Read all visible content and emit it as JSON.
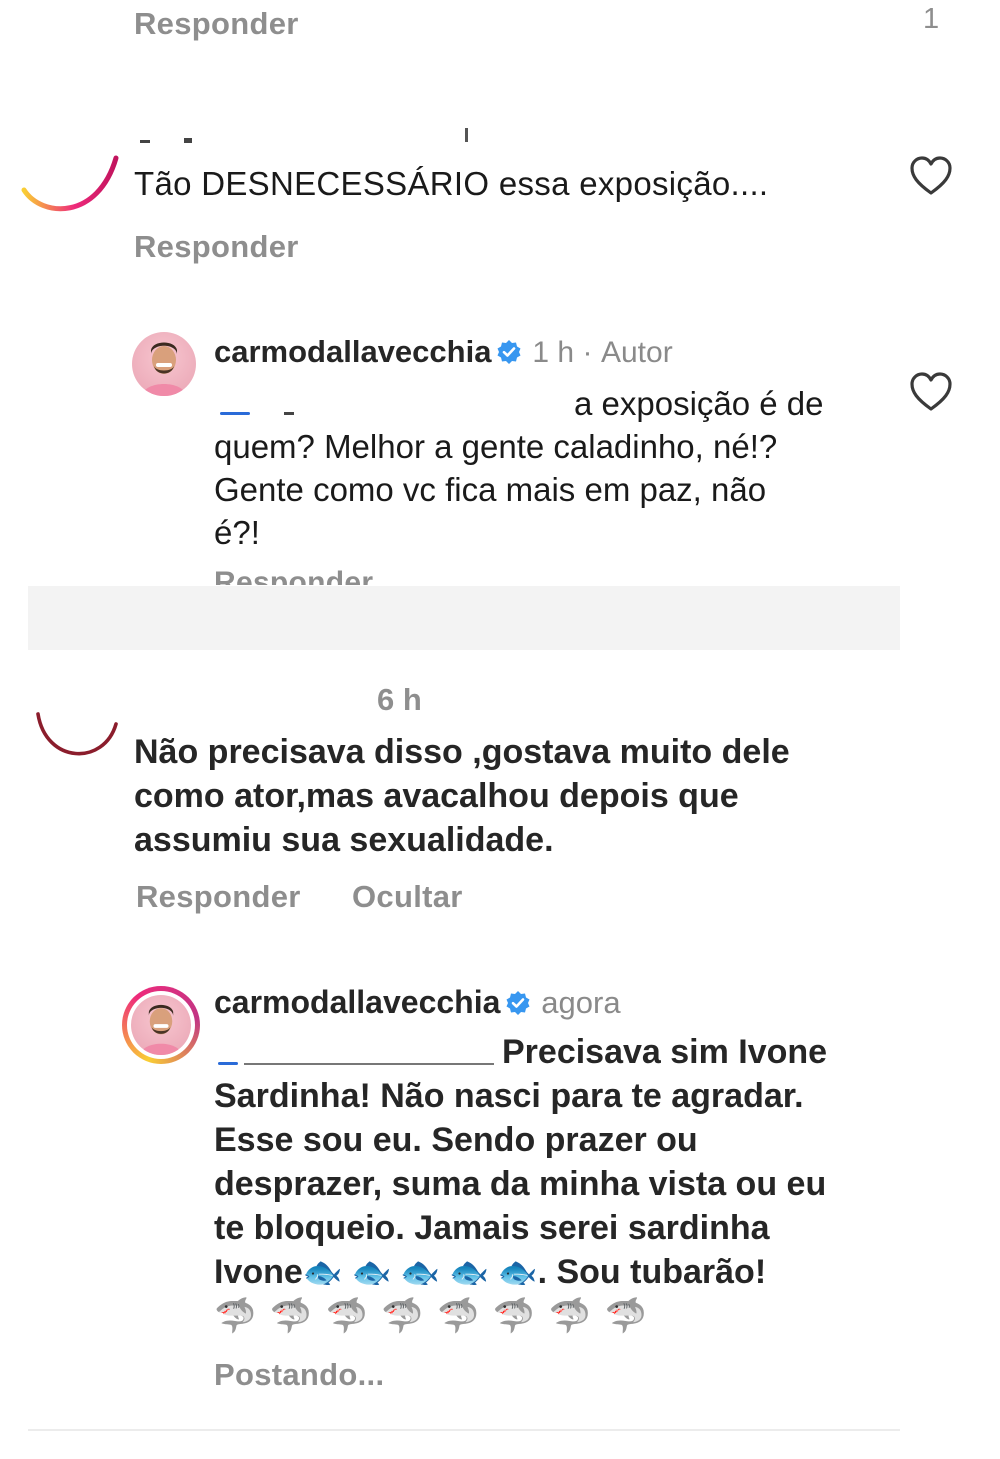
{
  "thread1": {
    "reply_label": "Responder",
    "like_count": "1"
  },
  "comment1": {
    "text": "Tão  DESNECESSÁRIO  essa  exposição....",
    "reply_label": "Responder"
  },
  "reply1": {
    "username": "carmodallavecchia",
    "time": "1 h",
    "separator": "·",
    "author_badge": "Autor",
    "text_line1": "a exposição é de",
    "text_line2": "quem? Melhor a gente caladinho, né!?",
    "text_line3": "Gente como vc fica mais em paz, não",
    "text_line4": "é?!",
    "reply_label": "Responder"
  },
  "comment2": {
    "time": "6 h",
    "text_line1": "Não precisava disso ,gostava muito dele",
    "text_line2": "como ator,mas avacalhou depois que",
    "text_line3": "assumiu sua sexualidade.",
    "reply_label": "Responder",
    "hide_label": "Ocultar"
  },
  "reply2": {
    "username": "carmodallavecchia",
    "time": "agora",
    "text_line1": "Precisava sim Ivone",
    "text_line2": "Sardinha! Não nasci para te agradar.",
    "text_line3": "Esse sou eu. Sendo prazer ou",
    "text_line4": "desprazer, suma da minha vista ou eu",
    "text_line5": "te bloqueio. Jamais serei sardinha",
    "text_line6_start": "Ivone",
    "fish_emojis": "🐟 🐟 🐟 🐟 🐟",
    "text_line6_end": ". Sou tubarão!",
    "shark_emojis": "🦈 🦈 🦈 🦈 🦈 🦈 🦈 🦈",
    "status": "Postando..."
  },
  "colors": {
    "verified": "#3897f0",
    "muted": "#8e8e8e",
    "redaction_line": "#2a6bd8",
    "story_ring_start": "#f9ce34",
    "story_ring_mid": "#ee2a7b",
    "story_ring_end": "#6228d7"
  }
}
